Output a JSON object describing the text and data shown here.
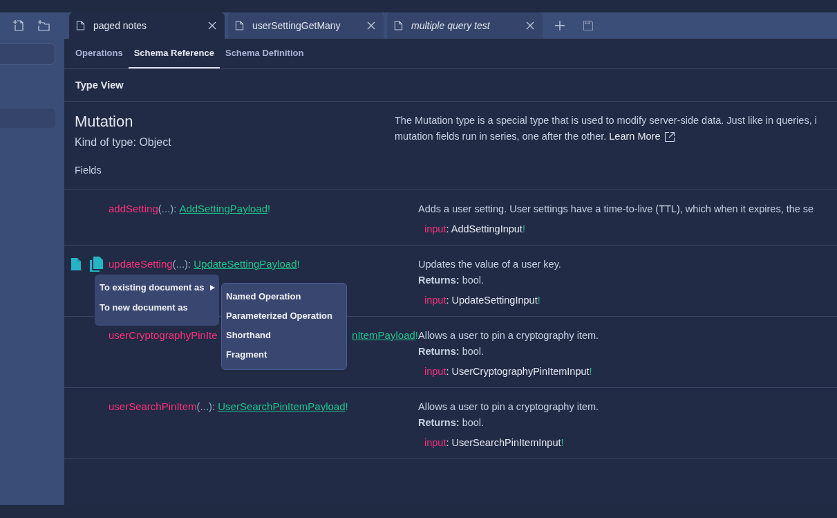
{
  "tabs": [
    {
      "label": "paged notes",
      "selected": true,
      "italic": false
    },
    {
      "label": "userSettingGetMany",
      "selected": false,
      "italic": false
    },
    {
      "label": "multiple query test",
      "selected": false,
      "italic": true
    }
  ],
  "view_tabs": [
    {
      "label": "Operations",
      "selected": false
    },
    {
      "label": "Schema Reference",
      "selected": true
    },
    {
      "label": "Schema Definition",
      "selected": false
    }
  ],
  "section_title": "Type View",
  "type": {
    "name": "Mutation",
    "kind": "Kind of type: Object",
    "description_lines": [
      "The Mutation type is a special type that is used to modify server-side data. Just like in queries, i",
      "mutation fields run in series, one after the other."
    ],
    "learn_more": "Learn More"
  },
  "fields_label": "Fields",
  "fields": [
    {
      "name": "addSetting",
      "args": "(...):",
      "type": "AddSettingPayload",
      "bang": "!",
      "description": "Adds a user setting. User settings have a time-to-live (TTL), which when it expires, the se",
      "arg_name": "input",
      "arg_type": ": AddSettingInput",
      "arg_bang": "!",
      "hovered": false,
      "clipped": false
    },
    {
      "name": "updateSetting",
      "args": "(...):",
      "type": "UpdateSettingPayload",
      "bang": "!",
      "description": "Updates the value of a user key.",
      "returns_label": "Returns:",
      "returns": "bool.",
      "arg_name": "input",
      "arg_type": ": UpdateSettingInput",
      "arg_bang": "!",
      "hovered": true,
      "clipped": false
    },
    {
      "name": "userCryptographyPinIte",
      "type": "nItemPayload",
      "bang": "!",
      "description": "Allows a user to pin a cryptography item.",
      "returns_label": "Returns:",
      "returns": "bool.",
      "arg_name": "input",
      "arg_type": ": UserCryptographyPinItemInput",
      "arg_bang": "!",
      "hovered": false,
      "clipped": true
    },
    {
      "name": "userSearchPinItem",
      "args": "(...):",
      "type": "UserSearchPinItemPayload",
      "bang": "!",
      "description": "Allows a user to pin a cryptography item.",
      "returns_label": "Returns:",
      "returns": "bool.",
      "arg_name": "input",
      "arg_type": ": UserSearchPinItemInput",
      "arg_bang": "!",
      "hovered": false,
      "clipped": false
    }
  ],
  "context_menu": {
    "items": [
      {
        "label": "To existing document as",
        "has_submenu": true
      },
      {
        "label": "To new document as",
        "has_submenu": false
      }
    ],
    "submenu": [
      "Named Operation",
      "Parameterized Operation",
      "Shorthand",
      "Fragment"
    ]
  }
}
